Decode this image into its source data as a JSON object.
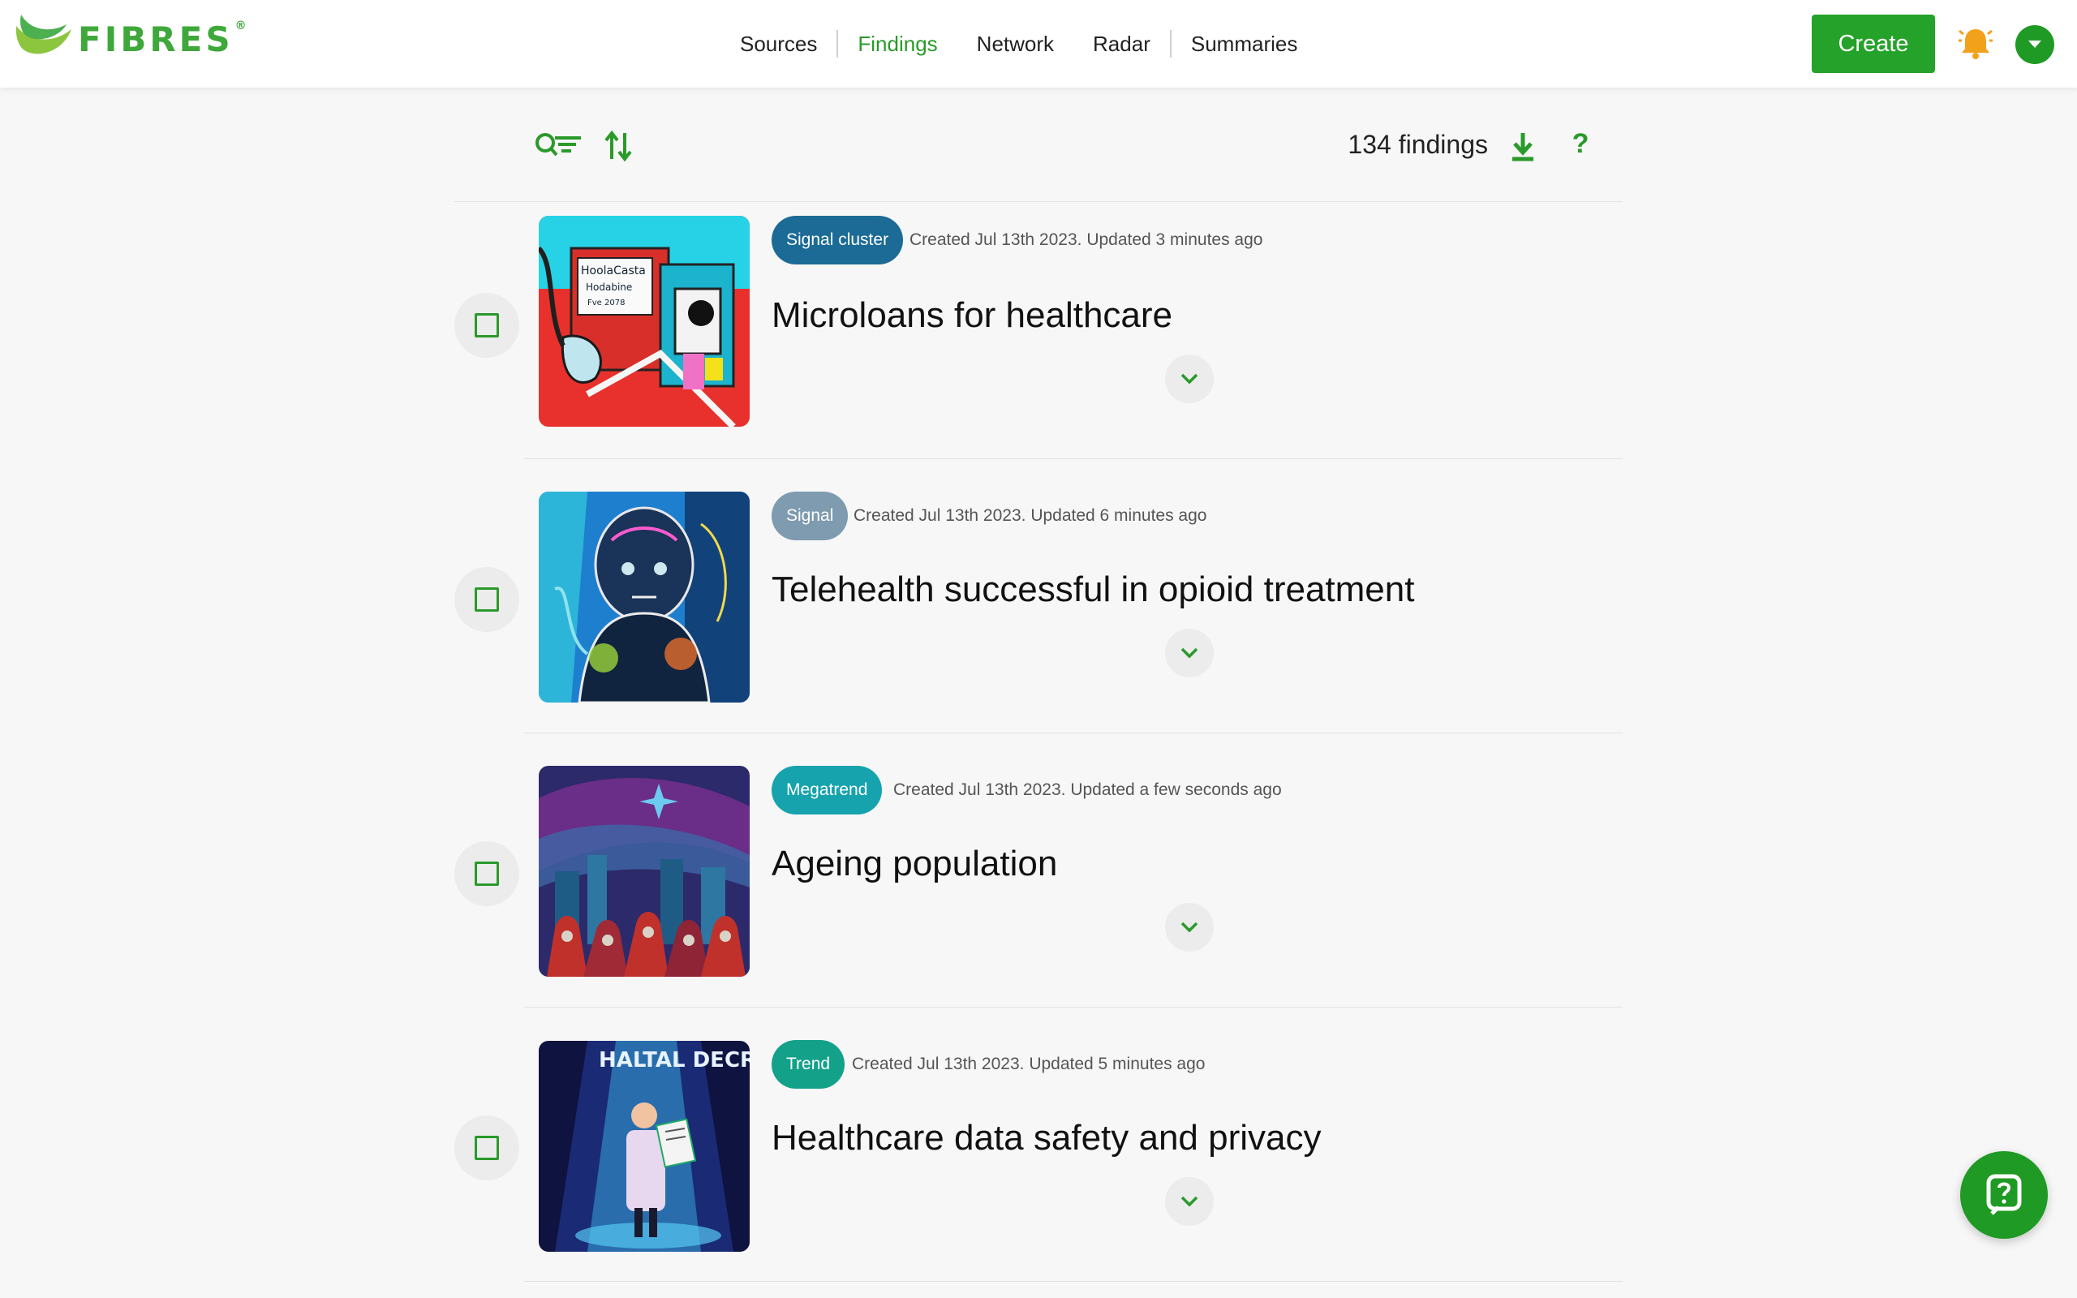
{
  "app": {
    "logo_text": "FIBRES",
    "logo_mark": "®",
    "brand_color": "#3ea83a",
    "accent": "#25a22a"
  },
  "nav": {
    "items": [
      {
        "label": "Sources",
        "active": false
      },
      {
        "label": "Findings",
        "active": true
      },
      {
        "label": "Network",
        "active": false
      },
      {
        "label": "Radar",
        "active": false
      },
      {
        "label": "Summaries",
        "active": false
      }
    ]
  },
  "header": {
    "create_label": "Create",
    "notification_icon": "bell-icon",
    "user_menu_icon": "chevron-down-icon"
  },
  "toolbar": {
    "count_label": "134 findings",
    "filter_icon": "search-filter-icon",
    "sort_icon": "sort-icon",
    "download_icon": "download-icon",
    "help_label": "?"
  },
  "findings": [
    {
      "type": "Signal cluster",
      "type_color": "#1b6b96",
      "meta": "Created Jul 13th 2023. Updated 3 minutes ago",
      "title": "Microloans for healthcare",
      "image": "healthcare-street-illustration"
    },
    {
      "type": "Signal",
      "type_color": "#7e9bb0",
      "meta": "Created Jul 13th 2023. Updated 6 minutes ago",
      "title": "Telehealth successful in opioid treatment",
      "image": "abstract-figure-painting"
    },
    {
      "type": "Megatrend",
      "type_color": "#17a3ae",
      "meta": "Created Jul 13th 2023. Updated a few seconds ago",
      "title": "Ageing population",
      "image": "hooded-figures-painting"
    },
    {
      "type": "Trend",
      "type_color": "#14a18a",
      "meta": "Created Jul 13th 2023. Updated 5 minutes ago",
      "title": "Healthcare data safety and privacy",
      "image": "doctor-poster-illustration",
      "image_text": "HALTAL DECRITY"
    }
  ],
  "chat": {
    "icon": "chat-icon"
  }
}
